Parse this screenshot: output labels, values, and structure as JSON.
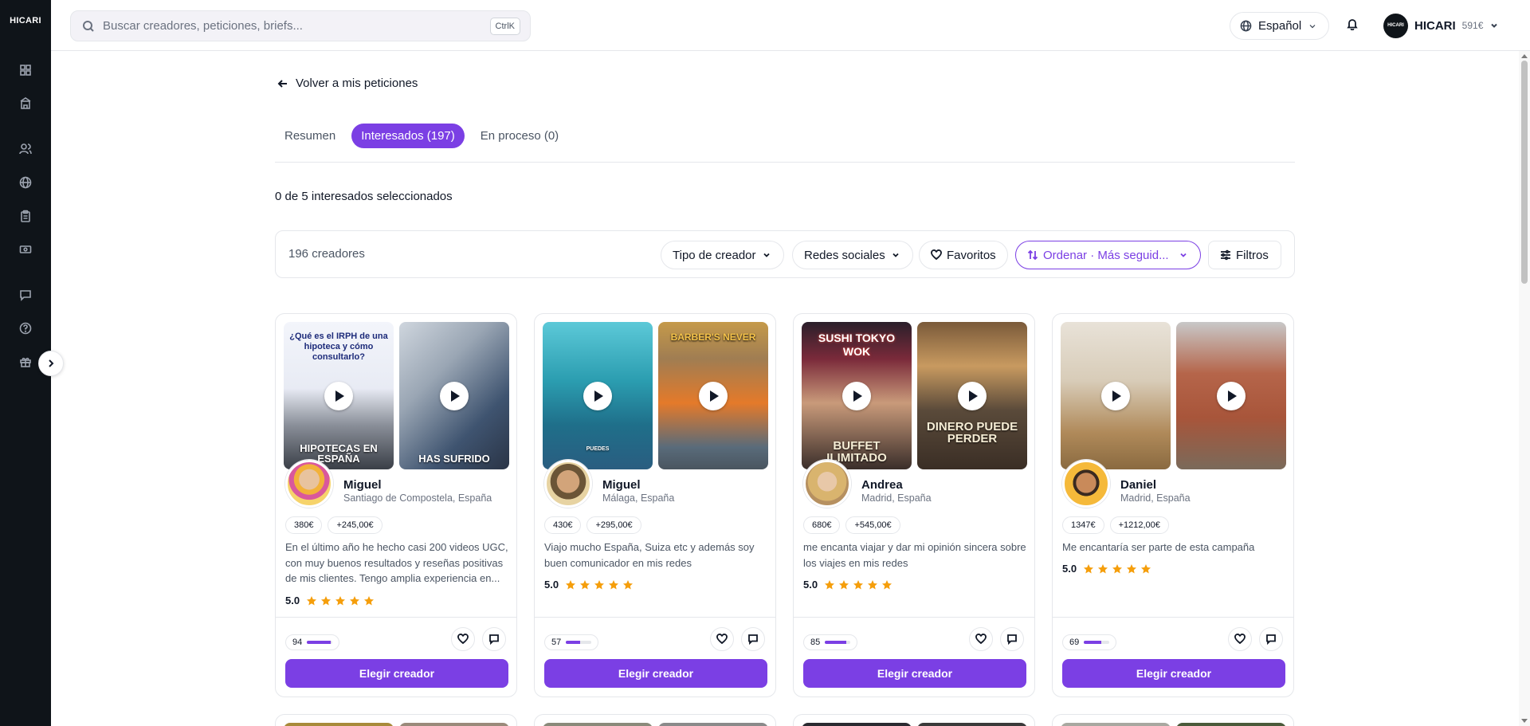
{
  "app": {
    "logo": "HICARI"
  },
  "topbar": {
    "search_placeholder": "Buscar creadores, peticiones, briefs...",
    "search_shortcut": "CtrlK",
    "language": "Español",
    "user_avatar": "HICARI",
    "user_name": "HICARI",
    "balance": "591€"
  },
  "sidebar": {
    "items": [
      {
        "icon": "dashboard-icon"
      },
      {
        "icon": "building-icon"
      },
      {
        "icon": "users-icon"
      },
      {
        "icon": "globe-icon"
      },
      {
        "icon": "clipboard-icon"
      },
      {
        "icon": "money-icon"
      },
      {
        "icon": "chat-icon"
      },
      {
        "icon": "help-icon"
      },
      {
        "icon": "gift-icon"
      }
    ]
  },
  "main": {
    "back_label": "Volver a mis peticiones",
    "tabs": [
      {
        "label": "Resumen",
        "active": false
      },
      {
        "label": "Interesados (197)",
        "active": true
      },
      {
        "label": "En proceso (0)",
        "active": false
      }
    ],
    "selected_text": "0 de 5 interesados seleccionados",
    "filters": {
      "count": "196 creadores",
      "creator_type": "Tipo de creador",
      "social": "Redes sociales",
      "favorites": "Favoritos",
      "sort": "Ordenar · Más seguid...",
      "filters": "Filtros"
    }
  },
  "cards": [
    {
      "name": "Miguel",
      "location": "Santiago de Compostela, España",
      "price": "380€",
      "earnings": "+245,00€",
      "description": "En el último año he hecho casi 200 videos UGC, con muy buenos resultados y reseñas positivas de mis clientes. Tengo amplia experiencia en...",
      "rating": "5.0",
      "score": "94",
      "score_fill": 0.94,
      "video1_top": "¿Qué es el IRPH de una hipoteca y cómo consultarlo?",
      "video1_caption": "HIPOTECAS EN ESPAÑA",
      "video2_caption": "HAS SUFRIDO",
      "cta": "Elegir creador"
    },
    {
      "name": "Miguel",
      "location": "Málaga, España",
      "price": "430€",
      "earnings": "+295,00€",
      "description": "Viajo mucho España, Suiza etc y además soy buen comunicador en mis redes",
      "rating": "5.0",
      "score": "57",
      "score_fill": 0.57,
      "video1_top": "",
      "video1_caption": "PUEDES",
      "video2_top": "BARBER'S NEVER",
      "video2_caption": "",
      "cta": "Elegir creador"
    },
    {
      "name": "Andrea",
      "location": "Madrid, España",
      "price": "680€",
      "earnings": "+545,00€",
      "description": "me encanta viajar y dar mi opinión sincera sobre los viajes en mis redes",
      "rating": "5.0",
      "score": "85",
      "score_fill": 0.85,
      "video1_top": "SUSHI TOKYO WOK",
      "video1_caption": "BUFFET ILIMITADO",
      "video2_caption": "DINERO PUEDE PERDER",
      "cta": "Elegir creador"
    },
    {
      "name": "Daniel",
      "location": "Madrid, España",
      "price": "1347€",
      "earnings": "+1212,00€",
      "description": "Me encantaría ser parte de esta campaña",
      "rating": "5.0",
      "score": "69",
      "score_fill": 0.69,
      "video1_caption": "",
      "video2_caption": "",
      "cta": "Elegir creador"
    }
  ],
  "colors": {
    "accent": "#7b3fe4",
    "sidebar": "#0f1419",
    "star": "#f59e0b"
  }
}
